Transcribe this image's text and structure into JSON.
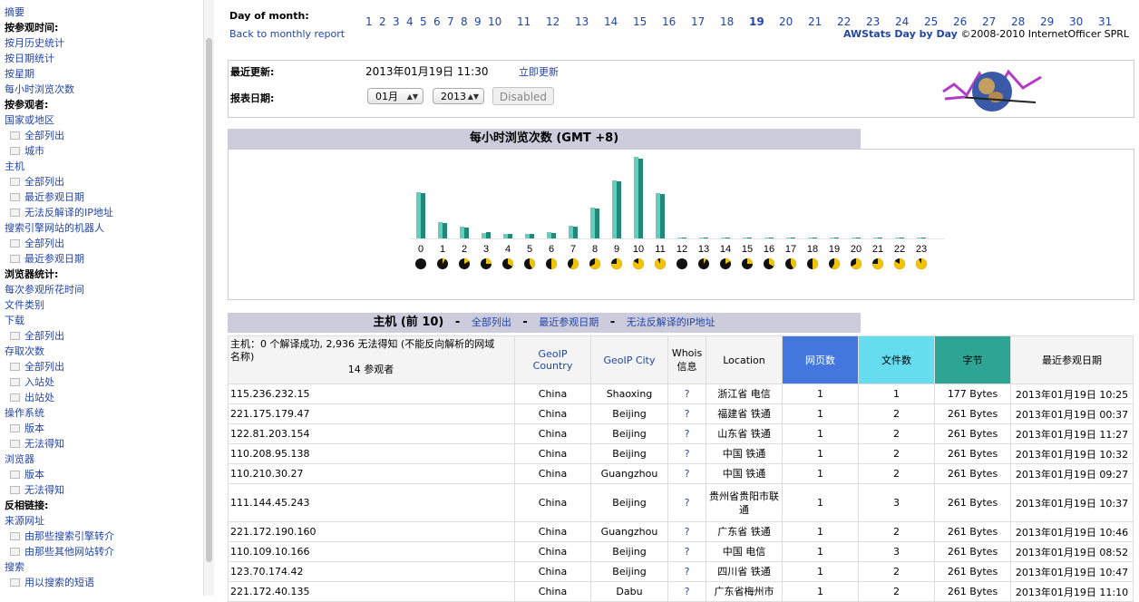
{
  "menu": {
    "items": [
      {
        "label": "摘要",
        "type": "link",
        "level": 0
      },
      {
        "label": "按参观时间:",
        "type": "bold",
        "level": 0
      },
      {
        "label": "按月历史统计",
        "type": "link",
        "level": 0
      },
      {
        "label": "按日期统计",
        "type": "link",
        "level": 0
      },
      {
        "label": "按星期",
        "type": "link",
        "level": 0
      },
      {
        "label": "每小时浏览次数",
        "type": "link",
        "level": 0
      },
      {
        "label": "按参观者:",
        "type": "bold",
        "level": 0
      },
      {
        "label": "国家或地区",
        "type": "link",
        "level": 0
      },
      {
        "label": "全部列出",
        "type": "link",
        "level": 1
      },
      {
        "label": "城市",
        "type": "link",
        "level": 1
      },
      {
        "label": "主机",
        "type": "link",
        "level": 0
      },
      {
        "label": "全部列出",
        "type": "link",
        "level": 1
      },
      {
        "label": "最近参观日期",
        "type": "link",
        "level": 1
      },
      {
        "label": "无法反解译的IP地址",
        "type": "link",
        "level": 1
      },
      {
        "label": "搜索引擎网站的机器人",
        "type": "link",
        "level": 0
      },
      {
        "label": "全部列出",
        "type": "link",
        "level": 1
      },
      {
        "label": "最近参观日期",
        "type": "link",
        "level": 1
      },
      {
        "label": "浏览器统计:",
        "type": "bold",
        "level": 0
      },
      {
        "label": "每次参观所花时间",
        "type": "link",
        "level": 0
      },
      {
        "label": "文件类别",
        "type": "link",
        "level": 0
      },
      {
        "label": "下载",
        "type": "link",
        "level": 0
      },
      {
        "label": "全部列出",
        "type": "link",
        "level": 1
      },
      {
        "label": "存取次数",
        "type": "link",
        "level": 0
      },
      {
        "label": "全部列出",
        "type": "link",
        "level": 1
      },
      {
        "label": "入站处",
        "type": "link",
        "level": 1
      },
      {
        "label": "出站处",
        "type": "link",
        "level": 1
      },
      {
        "label": "操作系统",
        "type": "link",
        "level": 0
      },
      {
        "label": "版本",
        "type": "link",
        "level": 1
      },
      {
        "label": "无法得知",
        "type": "link",
        "level": 1
      },
      {
        "label": "浏览器",
        "type": "link",
        "level": 0
      },
      {
        "label": "版本",
        "type": "link",
        "level": 1
      },
      {
        "label": "无法得知",
        "type": "link",
        "level": 1
      },
      {
        "label": "反相链接:",
        "type": "bold",
        "level": 0
      },
      {
        "label": "来源网址",
        "type": "link",
        "level": 0
      },
      {
        "label": "由那些搜索引擎转介",
        "type": "link",
        "level": 1
      },
      {
        "label": "由那些其他网站转介",
        "type": "link",
        "level": 1
      },
      {
        "label": "搜索",
        "type": "link",
        "level": 0
      },
      {
        "label": "用以搜索的短语",
        "type": "link",
        "level": 1
      }
    ]
  },
  "days_nav": {
    "label": "Day of month:",
    "days": [
      "1",
      "2",
      "3",
      "4",
      "5",
      "6",
      "7",
      "8",
      "9",
      "10",
      "11",
      "12",
      "13",
      "14",
      "15",
      "16",
      "17",
      "18",
      "19",
      "20",
      "21",
      "22",
      "23",
      "24",
      "25",
      "26",
      "27",
      "28",
      "29",
      "30",
      "31"
    ],
    "current": "19",
    "back_link": "Back to monthly report",
    "credit_link": "AWStats Day by Day",
    "credit_text": "©2008-2010 InternetOfficer SPRL"
  },
  "update": {
    "last_update_label": "最近更新:",
    "last_update_value": "2013年01月19日 11:30",
    "update_now": "立即更新",
    "report_date_label": "报表日期:",
    "month_value": "01月",
    "year_value": "2013",
    "disabled_button": "Disabled"
  },
  "hours_section": {
    "title": "每小时浏览次数 (GMT +8)"
  },
  "chart_data": {
    "type": "bar",
    "categories": [
      "0",
      "1",
      "2",
      "3",
      "4",
      "5",
      "6",
      "7",
      "8",
      "9",
      "10",
      "11",
      "12",
      "13",
      "14",
      "15",
      "16",
      "17",
      "18",
      "19",
      "20",
      "21",
      "22",
      "23"
    ],
    "series": [
      {
        "values": [
          51,
          18,
          13,
          6,
          5,
          5,
          7,
          14,
          34,
          64,
          90,
          50,
          0,
          0,
          0,
          0,
          0,
          0,
          0,
          0,
          0,
          0,
          0,
          0
        ]
      },
      {
        "values": [
          50,
          17,
          12,
          7,
          5,
          5,
          6,
          13,
          33,
          63,
          88,
          49,
          0,
          0,
          0,
          0,
          0,
          0,
          0,
          0,
          0,
          0,
          0,
          0
        ]
      }
    ],
    "colors": {
      "pages": "#66ccbb",
      "hits": "#228877"
    }
  },
  "hosts_section": {
    "title": "主机 (前 10)",
    "link_all": "全部列出",
    "link_last": "最近参观日期",
    "link_unresolved": "无法反解译的IP地址",
    "summary_line1": "主机：0 个解译成功, 2,936 无法得知 (不能反向解析的网域名称)",
    "summary_line2": "14 参观者",
    "col_country": "GeoIP Country",
    "col_city": "GeoIP City",
    "col_whois": "Whois 信息",
    "col_location": "Location",
    "col_pages": "网页数",
    "col_hits": "文件数",
    "col_bytes": "字节",
    "col_lastvisit": "最近参观日期",
    "rows": [
      {
        "host": "115.236.232.15",
        "country": "China",
        "city": "Shaoxing",
        "whois": "?",
        "location": "浙江省 电信",
        "pages": "1",
        "hits": "1",
        "bytes": "177 Bytes",
        "last": "2013年01月19日 10:25"
      },
      {
        "host": "221.175.179.47",
        "country": "China",
        "city": "Beijing",
        "whois": "?",
        "location": "福建省 铁通",
        "pages": "1",
        "hits": "2",
        "bytes": "261 Bytes",
        "last": "2013年01月19日 00:37"
      },
      {
        "host": "122.81.203.154",
        "country": "China",
        "city": "Beijing",
        "whois": "?",
        "location": "山东省 铁通",
        "pages": "1",
        "hits": "2",
        "bytes": "261 Bytes",
        "last": "2013年01月19日 11:27"
      },
      {
        "host": "110.208.95.138",
        "country": "China",
        "city": "Beijing",
        "whois": "?",
        "location": "中国 铁通",
        "pages": "1",
        "hits": "2",
        "bytes": "261 Bytes",
        "last": "2013年01月19日 10:32"
      },
      {
        "host": "110.210.30.27",
        "country": "China",
        "city": "Guangzhou",
        "whois": "?",
        "location": "中国 铁通",
        "pages": "1",
        "hits": "2",
        "bytes": "261 Bytes",
        "last": "2013年01月19日 09:27"
      },
      {
        "host": "111.144.45.243",
        "country": "China",
        "city": "Beijing",
        "whois": "?",
        "location": "贵州省贵阳市联通",
        "pages": "1",
        "hits": "3",
        "bytes": "261 Bytes",
        "last": "2013年01月19日 10:37"
      },
      {
        "host": "221.172.190.160",
        "country": "China",
        "city": "Guangzhou",
        "whois": "?",
        "location": "广东省 铁通",
        "pages": "1",
        "hits": "2",
        "bytes": "261 Bytes",
        "last": "2013年01月19日 10:46"
      },
      {
        "host": "110.109.10.166",
        "country": "China",
        "city": "Beijing",
        "whois": "?",
        "location": "中国 电信",
        "pages": "1",
        "hits": "3",
        "bytes": "261 Bytes",
        "last": "2013年01月19日 08:52"
      },
      {
        "host": "123.70.174.42",
        "country": "China",
        "city": "Beijing",
        "whois": "?",
        "location": "四川省 铁通",
        "pages": "1",
        "hits": "2",
        "bytes": "261 Bytes",
        "last": "2013年01月19日 10:47"
      },
      {
        "host": "221.172.40.135",
        "country": "China",
        "city": "Dabu",
        "whois": "?",
        "location": "广东省梅州市",
        "pages": "1",
        "hits": "2",
        "bytes": "261 Bytes",
        "last": "2013年01月19日 11:10"
      }
    ]
  }
}
